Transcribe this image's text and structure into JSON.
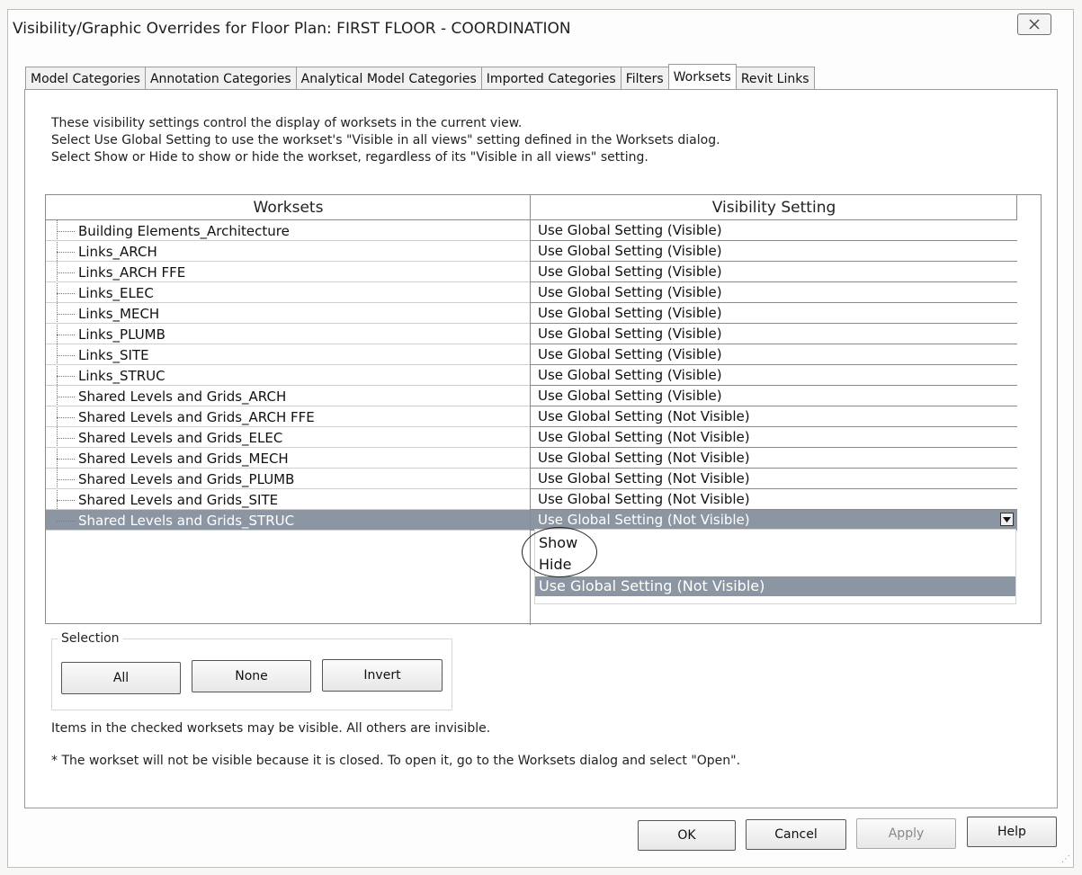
{
  "window": {
    "title": "Visibility/Graphic Overrides for Floor Plan: FIRST FLOOR - COORDINATION",
    "close_icon": "close-icon"
  },
  "tabs": [
    {
      "label": "Model Categories",
      "active": false
    },
    {
      "label": "Annotation Categories",
      "active": false
    },
    {
      "label": "Analytical Model Categories",
      "active": false
    },
    {
      "label": "Imported Categories",
      "active": false
    },
    {
      "label": "Filters",
      "active": false
    },
    {
      "label": "Worksets",
      "active": true
    },
    {
      "label": "Revit Links",
      "active": false
    }
  ],
  "description": [
    "These visibility settings control the display of worksets in the current view.",
    "Select Use Global Setting to use the workset's \"Visible in all views\" setting defined in the Worksets dialog.",
    "Select Show or Hide to show or hide the workset, regardless of its \"Visible in all views\" setting."
  ],
  "table": {
    "headers": {
      "worksets": "Worksets",
      "visibility": "Visibility Setting"
    },
    "rows": [
      {
        "workset": "Building Elements_Architecture",
        "visibility": "Use Global Setting (Visible)"
      },
      {
        "workset": "Links_ARCH",
        "visibility": "Use Global Setting (Visible)"
      },
      {
        "workset": "Links_ARCH FFE",
        "visibility": "Use Global Setting (Visible)"
      },
      {
        "workset": "Links_ELEC",
        "visibility": "Use Global Setting (Visible)"
      },
      {
        "workset": "Links_MECH",
        "visibility": "Use Global Setting (Visible)"
      },
      {
        "workset": "Links_PLUMB",
        "visibility": "Use Global Setting (Visible)"
      },
      {
        "workset": "Links_SITE",
        "visibility": "Use Global Setting (Visible)"
      },
      {
        "workset": "Links_STRUC",
        "visibility": "Use Global Setting (Visible)"
      },
      {
        "workset": "Shared Levels and Grids_ARCH",
        "visibility": "Use Global Setting (Visible)"
      },
      {
        "workset": "Shared Levels and Grids_ARCH FFE",
        "visibility": "Use Global Setting (Not Visible)"
      },
      {
        "workset": "Shared Levels and Grids_ELEC",
        "visibility": "Use Global Setting (Not Visible)"
      },
      {
        "workset": "Shared Levels and Grids_MECH",
        "visibility": "Use Global Setting (Not Visible)"
      },
      {
        "workset": "Shared Levels and Grids_PLUMB",
        "visibility": "Use Global Setting (Not Visible)"
      },
      {
        "workset": "Shared Levels and Grids_SITE",
        "visibility": "Use Global Setting (Not Visible)"
      },
      {
        "workset": "Shared Levels and Grids_STRUC",
        "visibility": "Use Global Setting (Not Visible)",
        "selected": true
      }
    ],
    "dropdown_options": [
      "Show",
      "Hide",
      "Use Global Setting (Not Visible)"
    ],
    "dropdown_selected": "Use Global Setting (Not Visible)"
  },
  "selection": {
    "label": "Selection",
    "all_label": "All",
    "none_label": "None",
    "invert_label": "Invert"
  },
  "notes": {
    "checked": "Items in the checked worksets may be visible.  All others are invisible.",
    "closed": "* The workset will not be visible because it is closed. To open it, go to the Worksets dialog and select \"Open\"."
  },
  "footer": {
    "ok_label": "OK",
    "cancel_label": "Cancel",
    "apply_label": "Apply",
    "help_label": "Help"
  },
  "colors": {
    "selection": "#8c96a3",
    "border": "#8a8a8a"
  }
}
